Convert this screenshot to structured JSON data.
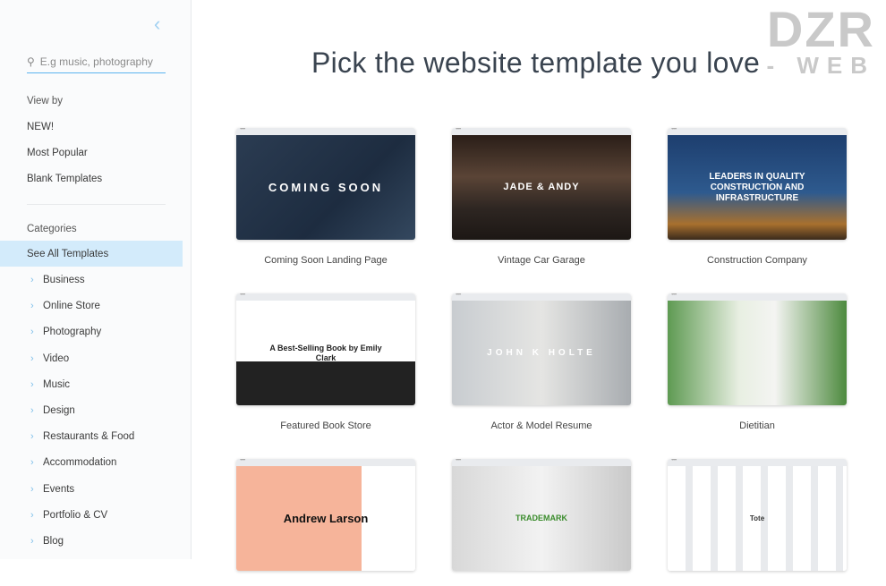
{
  "sidebar": {
    "search_placeholder": "E.g music, photography",
    "view_by": "View by",
    "view_items": [
      "NEW!",
      "Most Popular",
      "Blank Templates"
    ],
    "categories_label": "Categories",
    "active": "See All Templates",
    "categories": [
      "Business",
      "Online Store",
      "Photography",
      "Video",
      "Music",
      "Design",
      "Restaurants & Food",
      "Accommodation",
      "Events",
      "Portfolio & CV",
      "Blog"
    ]
  },
  "main": {
    "title": "Pick the website template you love"
  },
  "watermark": {
    "line1": "DZR",
    "line2": "- WEB"
  },
  "templates": [
    {
      "name": "Coming Soon Landing Page",
      "thumb_text": "COMING SOON"
    },
    {
      "name": "Vintage Car Garage",
      "thumb_text": "JADE & ANDY"
    },
    {
      "name": "Construction Company",
      "thumb_text": "LEADERS IN QUALITY CONSTRUCTION AND INFRASTRUCTURE"
    },
    {
      "name": "Featured Book Store",
      "thumb_text": "A Best-Selling Book by Emily Clark"
    },
    {
      "name": "Actor & Model Resume",
      "thumb_text": "JOHN K HOLTE"
    },
    {
      "name": "Dietitian",
      "thumb_text": ""
    },
    {
      "name": "",
      "thumb_text": "Andrew Larson"
    },
    {
      "name": "",
      "thumb_text": "TRADEMARK"
    },
    {
      "name": "",
      "thumb_text": "Tote"
    }
  ]
}
